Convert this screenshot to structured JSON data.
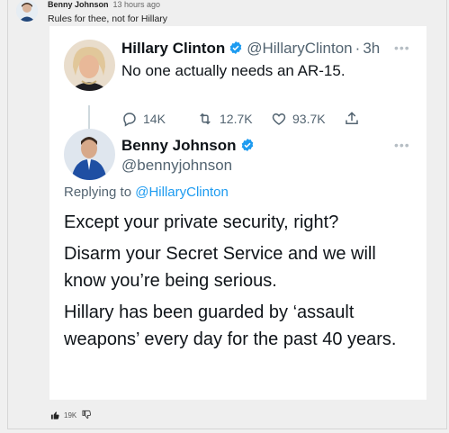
{
  "post": {
    "author": "Benny Johnson",
    "time": "13 hours ago",
    "text": "Rules for thee, not for Hillary",
    "likes": "19K"
  },
  "original_tweet": {
    "name": "Hillary Clinton",
    "handle": "@HillaryClinton",
    "age": "3h",
    "sep": "·",
    "text": "No one actually needs an AR-15.",
    "replies": "14K",
    "retweets": "12.7K",
    "likes": "93.7K"
  },
  "reply_tweet": {
    "name": "Benny Johnson",
    "handle": "@bennyjohnson",
    "replying_to_label": "Replying to",
    "replying_to_handle": "@HillaryClinton",
    "paragraphs": [
      "Except your private security, right?",
      "Disarm your Secret Service and we will know you’re being serious.",
      "Hillary has been guarded by ‘assault weapons’ every day for the past 40 years."
    ]
  },
  "colors": {
    "verified": "#1d9bf0",
    "link": "#1d9bf0"
  }
}
